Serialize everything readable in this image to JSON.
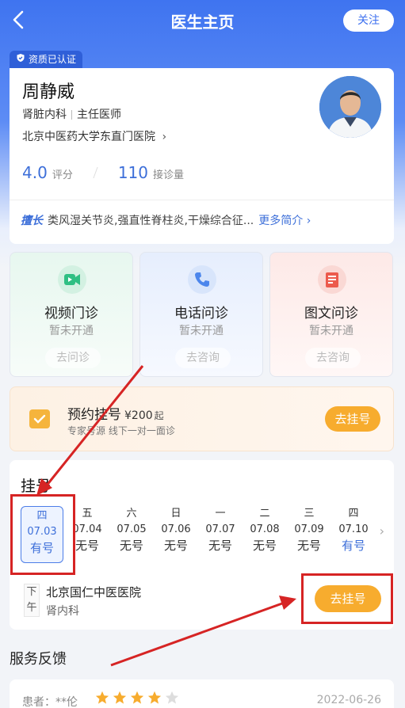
{
  "header": {
    "title": "医生主页",
    "follow_label": "关注"
  },
  "badge": {
    "label": "资质已认证"
  },
  "doctor": {
    "name": "周静威",
    "department": "肾脏内科",
    "title": "主任医师",
    "hospital": "北京中医药大学东直门医院",
    "rating_value": "4.0",
    "rating_label": "评分",
    "consult_count": "110",
    "consult_label": "接诊量",
    "specialty_tag": "擅长",
    "specialty": "类风湿关节炎,强直性脊柱炎,干燥综合征...",
    "more_label": "更多简介"
  },
  "services": [
    {
      "name": "视频门诊",
      "status": "暂未开通",
      "button": "去问诊"
    },
    {
      "name": "电话问诊",
      "status": "暂未开通",
      "button": "去咨询"
    },
    {
      "name": "图文问诊",
      "status": "暂未开通",
      "button": "去咨询"
    }
  ],
  "appointment": {
    "title": "预约挂号",
    "price": "¥200",
    "price_suffix": "起",
    "subtitle": "专家号源 线下一对一面诊",
    "button": "去挂号"
  },
  "registration": {
    "title": "挂号",
    "days": [
      {
        "weekday": "四",
        "date": "07.03",
        "status": "有号"
      },
      {
        "weekday": "五",
        "date": "07.04",
        "status": "无号"
      },
      {
        "weekday": "六",
        "date": "07.05",
        "status": "无号"
      },
      {
        "weekday": "日",
        "date": "07.06",
        "status": "无号"
      },
      {
        "weekday": "一",
        "date": "07.07",
        "status": "无号"
      },
      {
        "weekday": "二",
        "date": "07.08",
        "status": "无号"
      },
      {
        "weekday": "三",
        "date": "07.09",
        "status": "无号"
      },
      {
        "weekday": "四",
        "date": "07.10",
        "status": "有号"
      }
    ],
    "slot": {
      "half_top": "下",
      "half_bottom": "午",
      "hospital": "北京国仁中医医院",
      "department": "肾内科",
      "button": "去挂号"
    }
  },
  "feedback": {
    "title": "服务反馈",
    "review": {
      "patient": "患者：**伦",
      "stars": 4,
      "max_stars": 5,
      "date": "2022-06-26"
    }
  },
  "colors": {
    "brand": "#3f74f0",
    "accent_orange": "#f7ac2e",
    "annotation_red": "#d62424"
  }
}
